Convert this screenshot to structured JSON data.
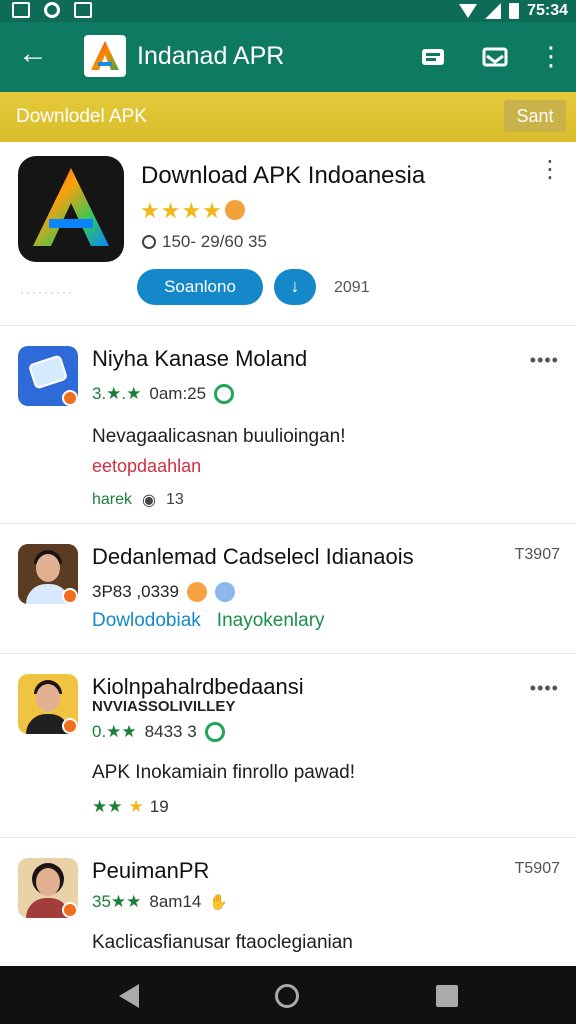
{
  "status_bar": {
    "time": "75:34"
  },
  "app_bar": {
    "title": "Indanad APR"
  },
  "banner": {
    "text": "Downlodel APK",
    "button_label": "Sant"
  },
  "featured": {
    "name": "Download APK Indoanesia",
    "stars": "★★★★",
    "meta": "150- 29/60 35",
    "primary_button": "Soanlono",
    "share_icon": "↓",
    "count": "2091"
  },
  "items": [
    {
      "title": "Niyha Kanase Moland",
      "rating": "3.★.★",
      "rating_text": "0am:25",
      "desc": "Nevagaalicasnan buulioingan!",
      "desc2": "eetopdaahlan",
      "tag": "harek",
      "count": "13"
    },
    {
      "title": "Dedanlemad Cadselecl Idianaois",
      "code": "T3907",
      "rating": "3P83 ,0339",
      "link1": "Dowlodobiak",
      "link2": "Inayokenlary"
    },
    {
      "title": "Kiolnpahalrdbedaansi",
      "subtitle": "NVVIASSOLIVILLEY",
      "rating": "0.★★",
      "rating_text": "8433 3",
      "desc": "APK Inokamiain finrollo pawad!",
      "stars": "★★",
      "count": "19"
    },
    {
      "title": "PeuimanPR",
      "code": "T5907",
      "rating": "35★★",
      "rating_text": "8am14",
      "desc": "Kaclicasfianusar ftaoclegianian"
    }
  ],
  "icons": {
    "back": "back-arrow-icon",
    "more": "vertical-more-icon",
    "phone": "phone-icon",
    "person": "person-avatar"
  }
}
